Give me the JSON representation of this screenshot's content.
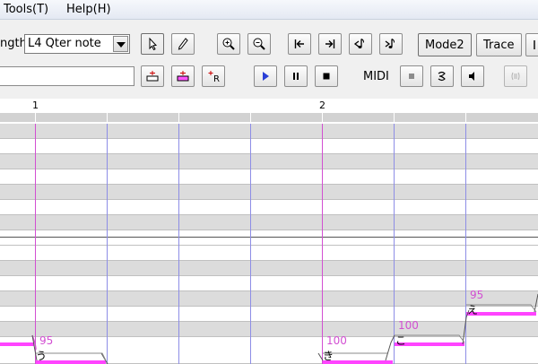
{
  "menu": {
    "tools": "Tools(T)",
    "help": "Help(H)"
  },
  "toolbar": {
    "length_label": "ngth",
    "length_value": "L4  Qter note",
    "mode2_label": "Mode2",
    "trace_label": "Trace",
    "midi_label": "MIDI",
    "search_value": ""
  },
  "icons": {
    "select": "cursor-arrow-icon",
    "pencil": "pencil-icon",
    "zoom_in": "zoom-in-icon",
    "zoom_out": "zoom-out-icon",
    "go_start": "go-start-icon",
    "go_end": "go-end-icon",
    "play": "play-icon",
    "pause": "pause-icon",
    "stop": "stop-icon"
  },
  "ruler": {
    "measure1": "1",
    "measure2": "2"
  },
  "notes": [
    {
      "velocity": "95",
      "lyric": "う"
    },
    {
      "velocity": "100",
      "lyric": "き"
    },
    {
      "velocity": "100",
      "lyric": "こ"
    },
    {
      "velocity": "95",
      "lyric": "え"
    }
  ],
  "colors": {
    "note": "#ff44ff",
    "bar_line": "#d24fd2",
    "beat_line": "#8d8de6",
    "lane_gray": "#dcdcdc"
  }
}
